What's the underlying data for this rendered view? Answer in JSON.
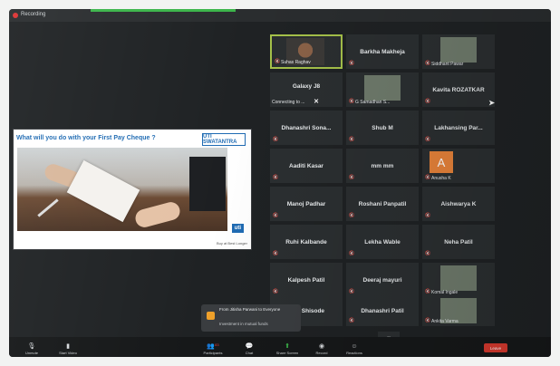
{
  "window": {
    "recording_label": "Recording"
  },
  "slide": {
    "title": "What will you do with your First Pay Cheque ?",
    "logo": "UTI SWATANTRA",
    "badge": "uti",
    "footer": "Buy at Best Longer"
  },
  "participants": [
    {
      "name": "Suhas Raghav",
      "kind": "video",
      "active": true
    },
    {
      "name": "Barkha Makheja",
      "kind": "name"
    },
    {
      "name": "Siddhant Pawar",
      "kind": "thumb"
    },
    {
      "name": "Galaxy J8",
      "kind": "name",
      "sub": "Connecting to ..."
    },
    {
      "name": "G Samadhan S...",
      "kind": "thumb"
    },
    {
      "name": "Kavita ROZATKAR",
      "kind": "name"
    },
    {
      "name": "Dhanashri Sona...",
      "kind": "name"
    },
    {
      "name": "Shub M",
      "kind": "name"
    },
    {
      "name": "Lakhansing Par...",
      "kind": "name"
    },
    {
      "name": "Aaditi Kasar",
      "kind": "name"
    },
    {
      "name": "mm mm",
      "kind": "name"
    },
    {
      "name": "Anusha K",
      "kind": "avatar",
      "initial": "A"
    },
    {
      "name": "Manoj Padhar",
      "kind": "name"
    },
    {
      "name": "Roshani Panpatil",
      "kind": "name"
    },
    {
      "name": "Aishwarya K",
      "kind": "name"
    },
    {
      "name": "Ruhi Kalbande",
      "kind": "name"
    },
    {
      "name": "Lekha Wable",
      "kind": "name"
    },
    {
      "name": "Neha Patil",
      "kind": "name"
    },
    {
      "name": "Kalpesh Patil",
      "kind": "name"
    },
    {
      "name": "Deeraj mayuri",
      "kind": "name"
    },
    {
      "name": "Komal Ingale",
      "kind": "thumb"
    },
    {
      "name": "njali Shisode",
      "kind": "name"
    },
    {
      "name": "Dhanashri Patil",
      "kind": "name"
    },
    {
      "name": "Ankita Varma",
      "kind": "thumb"
    }
  ],
  "chat_toast": {
    "from": "From Jitisha Parwani to Everyone",
    "message": "Investment in mutual funds"
  },
  "toolbar": {
    "unmute": "Unmute",
    "start_video": "Start Video",
    "participants": "Participants",
    "participants_count": "83",
    "chat": "Chat",
    "share_screen": "Share Screen",
    "record": "Record",
    "reactions": "Reactions",
    "end": "Leave"
  },
  "icons": [
    "mic-off-icon",
    "video-off-icon",
    "participants-icon",
    "chat-icon",
    "share-screen-icon",
    "record-icon",
    "reactions-icon",
    "chevron-down-icon",
    "cursor-icon"
  ],
  "colors": {
    "active_speaker": "#a6c24a",
    "share_green": "#3bb54a",
    "end_red": "#d93a2f",
    "avatar_orange": "#e8833a"
  }
}
